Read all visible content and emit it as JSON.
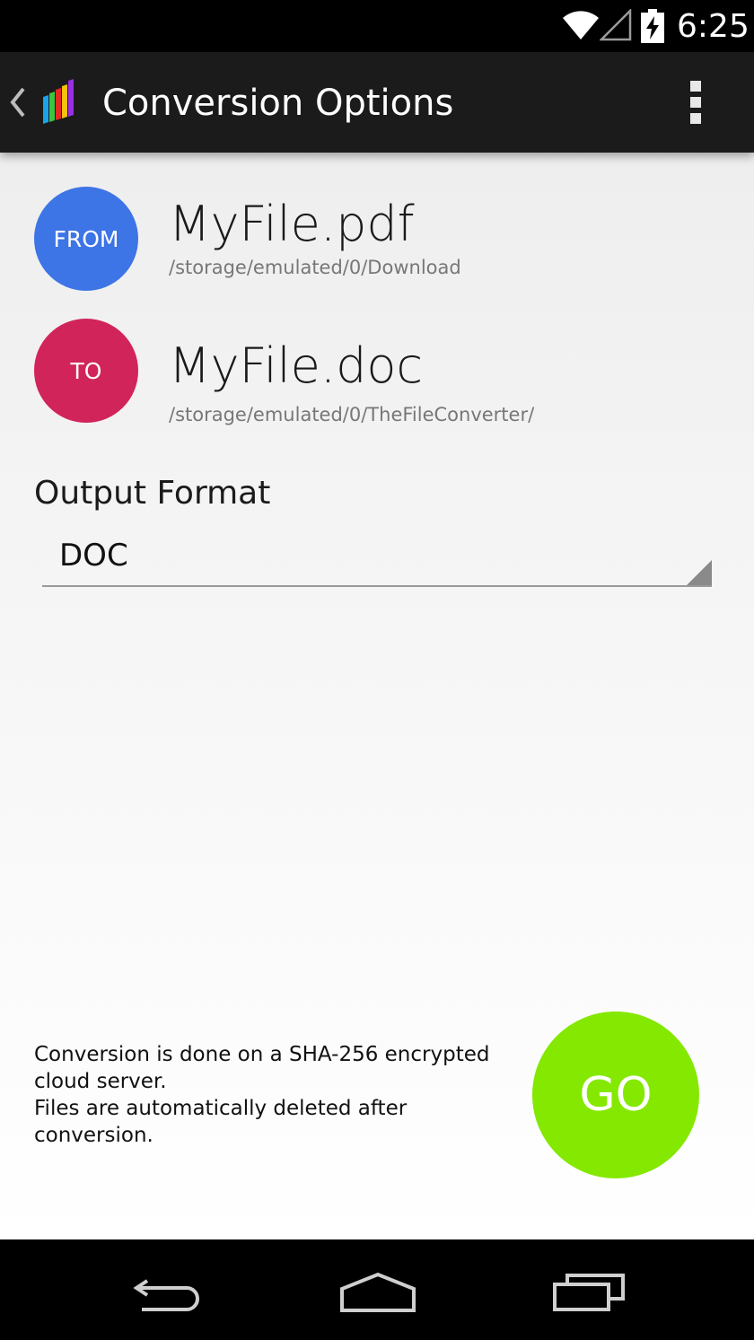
{
  "status_bar": {
    "time": "6:25",
    "icons": [
      "wifi-icon",
      "cell-signal-icon",
      "battery-charging-icon"
    ]
  },
  "action_bar": {
    "title": "Conversion Options",
    "icons": [
      "back-caret-icon",
      "app-logo-icon",
      "overflow-menu-icon"
    ]
  },
  "source": {
    "badge": "FROM",
    "filename": "MyFile.pdf",
    "path": "/storage/emulated/0/Download",
    "color": "#3d74e6"
  },
  "destination": {
    "badge": "TO",
    "filename": "MyFile.doc",
    "path": "/storage/emulated/0/TheFileConverter/",
    "color": "#d1245a"
  },
  "output_format": {
    "label": "Output Format",
    "selected": "DOC"
  },
  "notice": {
    "line1": "Conversion is done on a SHA-256 encrypted cloud server.",
    "line2": "Files are automatically deleted after conversion."
  },
  "go_button": {
    "label": "GO",
    "color": "#84e800"
  },
  "nav_bar": {
    "icons": [
      "nav-back-icon",
      "nav-home-icon",
      "nav-recents-icon"
    ]
  }
}
